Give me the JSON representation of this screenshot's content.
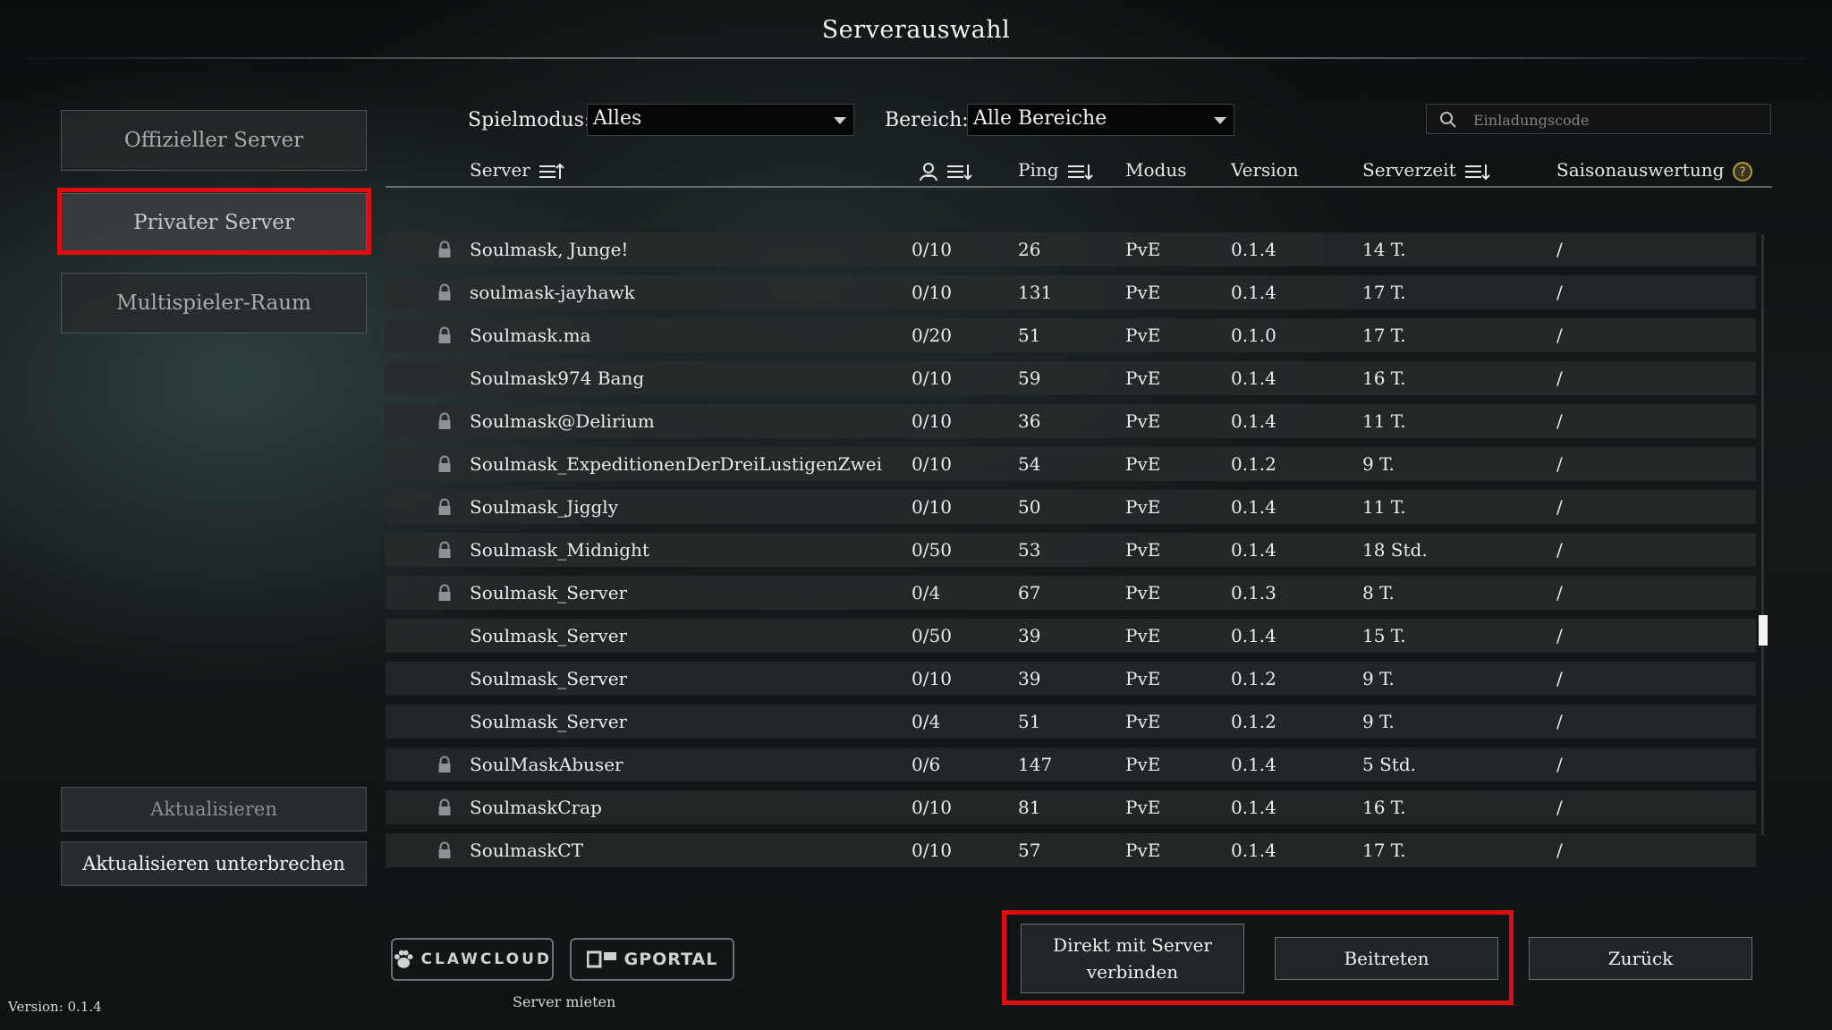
{
  "window": {
    "title": "Serverauswahl",
    "version_label": "Version: 0.1.4"
  },
  "sidebar": {
    "items": [
      {
        "label": "Offizieller Server",
        "active": false
      },
      {
        "label": "Privater Server",
        "active": true
      },
      {
        "label": "Multispieler-Raum",
        "active": false
      }
    ],
    "refresh_label": "Aktualisieren",
    "stop_refresh_label": "Aktualisieren unterbrechen"
  },
  "filters": {
    "game_mode_label": "Spielmodus:",
    "game_mode_value": "Alles",
    "region_label": "Bereich:",
    "region_value": "Alle Bereiche",
    "invite_placeholder": "Einladungscode"
  },
  "table": {
    "headers": {
      "server": "Server",
      "ping": "Ping",
      "mode": "Modus",
      "version": "Version",
      "server_time": "Serverzeit",
      "season": "Saisonauswertung"
    },
    "rows": [
      {
        "locked": true,
        "name": "Soulmask, Junge!",
        "players": "0/10",
        "ping": "26",
        "mode": "PvE",
        "version": "0.1.4",
        "time": "14 T.",
        "season": "/"
      },
      {
        "locked": true,
        "name": "soulmask-jayhawk",
        "players": "0/10",
        "ping": "131",
        "mode": "PvE",
        "version": "0.1.4",
        "time": "17 T.",
        "season": "/"
      },
      {
        "locked": true,
        "name": "Soulmask.ma",
        "players": "0/20",
        "ping": "51",
        "mode": "PvE",
        "version": "0.1.0",
        "time": "17 T.",
        "season": "/"
      },
      {
        "locked": false,
        "name": "Soulmask974 Bang",
        "players": "0/10",
        "ping": "59",
        "mode": "PvE",
        "version": "0.1.4",
        "time": "16 T.",
        "season": "/"
      },
      {
        "locked": true,
        "name": "Soulmask@Delirium",
        "players": "0/10",
        "ping": "36",
        "mode": "PvE",
        "version": "0.1.4",
        "time": "11 T.",
        "season": "/"
      },
      {
        "locked": true,
        "name": "Soulmask_ExpeditionenDerDreiLustigenZwei",
        "players": "0/10",
        "ping": "54",
        "mode": "PvE",
        "version": "0.1.2",
        "time": "9 T.",
        "season": "/"
      },
      {
        "locked": true,
        "name": "Soulmask_Jiggly",
        "players": "0/10",
        "ping": "50",
        "mode": "PvE",
        "version": "0.1.4",
        "time": "11 T.",
        "season": "/"
      },
      {
        "locked": true,
        "name": "Soulmask_Midnight",
        "players": "0/50",
        "ping": "53",
        "mode": "PvE",
        "version": "0.1.4",
        "time": "18 Std.",
        "season": "/"
      },
      {
        "locked": true,
        "name": "Soulmask_Server",
        "players": "0/4",
        "ping": "67",
        "mode": "PvE",
        "version": "0.1.3",
        "time": "8 T.",
        "season": "/"
      },
      {
        "locked": false,
        "name": "Soulmask_Server",
        "players": "0/50",
        "ping": "39",
        "mode": "PvE",
        "version": "0.1.4",
        "time": "15 T.",
        "season": "/"
      },
      {
        "locked": false,
        "name": "Soulmask_Server",
        "players": "0/10",
        "ping": "39",
        "mode": "PvE",
        "version": "0.1.2",
        "time": "9 T.",
        "season": "/"
      },
      {
        "locked": false,
        "name": "Soulmask_Server",
        "players": "0/4",
        "ping": "51",
        "mode": "PvE",
        "version": "0.1.2",
        "time": "9 T.",
        "season": "/"
      },
      {
        "locked": true,
        "name": "SoulMaskAbuser",
        "players": "0/6",
        "ping": "147",
        "mode": "PvE",
        "version": "0.1.4",
        "time": "5 Std.",
        "season": "/"
      },
      {
        "locked": true,
        "name": "SoulmaskCrap",
        "players": "0/10",
        "ping": "81",
        "mode": "PvE",
        "version": "0.1.4",
        "time": "16 T.",
        "season": "/"
      },
      {
        "locked": true,
        "name": "SoulmaskCT",
        "players": "0/10",
        "ping": "57",
        "mode": "PvE",
        "version": "0.1.4",
        "time": "17 T.",
        "season": "/"
      }
    ]
  },
  "partners": {
    "clawcloud": "CLAWCLOUD",
    "gportal": "GPORTAL",
    "rent_label": "Server mieten"
  },
  "actions": {
    "direct_connect": "Direkt mit Server verbinden",
    "join": "Beitreten",
    "back": "Zurück"
  },
  "colors": {
    "highlight": "#e00d10",
    "row_bg": "#282b2d",
    "accent_text": "#f2f2f2"
  }
}
